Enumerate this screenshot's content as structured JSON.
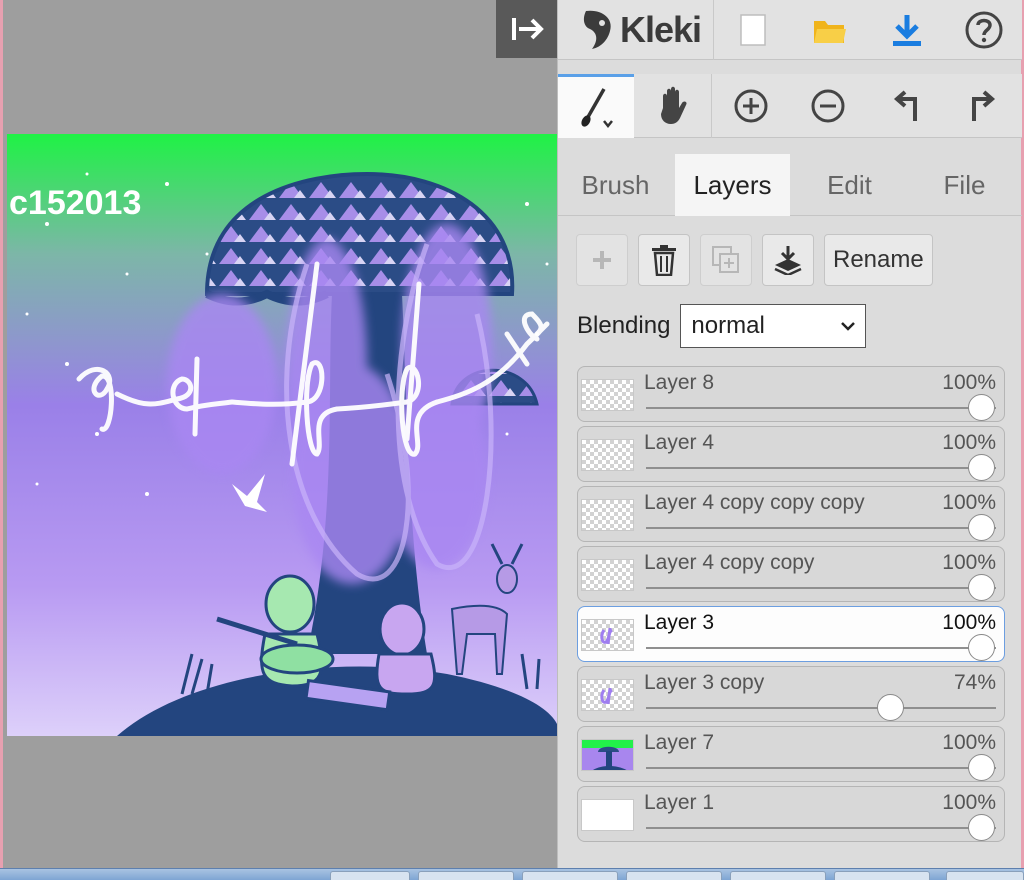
{
  "app": {
    "name": "Kleki"
  },
  "canvas": {
    "overlay_text": "c152013"
  },
  "tabs": [
    {
      "label": "Brush"
    },
    {
      "label": "Layers"
    },
    {
      "label": "Edit"
    },
    {
      "label": "File"
    }
  ],
  "active_tab": "Layers",
  "layer_toolbar": {
    "rename_label": "Rename"
  },
  "blending": {
    "label": "Blending",
    "value": "normal"
  },
  "layers": [
    {
      "name": "Layer 8",
      "opacity": "100%",
      "opacity_value": 1.0,
      "selected": false,
      "thumb": "transparent"
    },
    {
      "name": "Layer 4",
      "opacity": "100%",
      "opacity_value": 1.0,
      "selected": false,
      "thumb": "transparent"
    },
    {
      "name": "Layer 4 copy copy copy",
      "opacity": "100%",
      "opacity_value": 1.0,
      "selected": false,
      "thumb": "transparent"
    },
    {
      "name": "Layer 4 copy copy",
      "opacity": "100%",
      "opacity_value": 1.0,
      "selected": false,
      "thumb": "transparent"
    },
    {
      "name": "Layer 3",
      "opacity": "100%",
      "opacity_value": 1.0,
      "selected": true,
      "thumb": "purple-scribble"
    },
    {
      "name": "Layer 3 copy",
      "opacity": "74%",
      "opacity_value": 0.74,
      "selected": false,
      "thumb": "purple-scribble"
    },
    {
      "name": "Layer 7",
      "opacity": "100%",
      "opacity_value": 1.0,
      "selected": false,
      "thumb": "artwork"
    },
    {
      "name": "Layer 1",
      "opacity": "100%",
      "opacity_value": 1.0,
      "selected": false,
      "thumb": "white"
    }
  ],
  "colors": {
    "accent": "#5aa0e8",
    "canvas_top": "#22f04a",
    "canvas_purple": "#a57cf0",
    "hill": "#23457f"
  }
}
